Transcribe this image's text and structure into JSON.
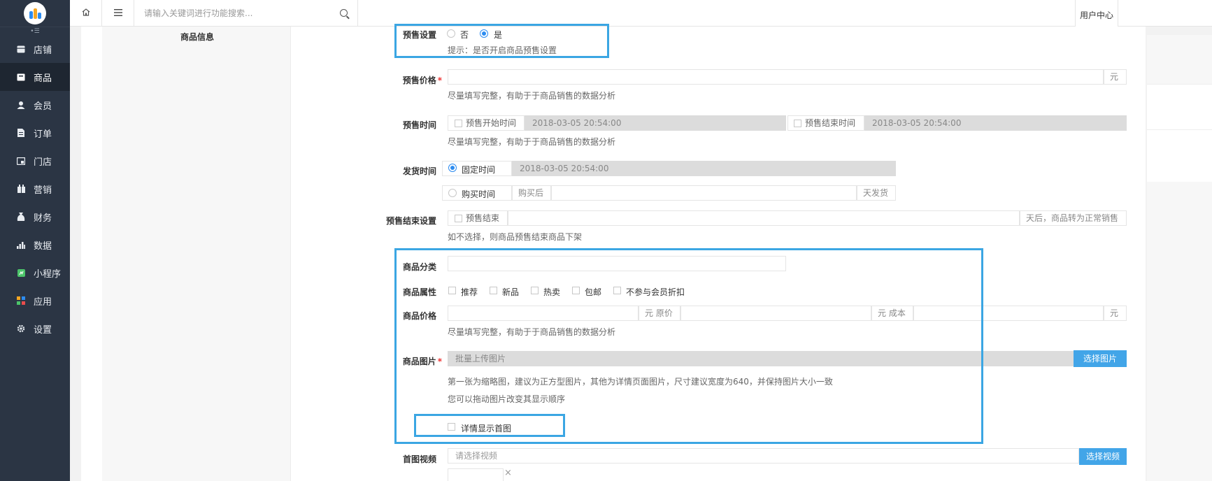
{
  "nav": {
    "items": [
      {
        "label": "店铺",
        "icon": "store-icon"
      },
      {
        "label": "商品",
        "icon": "goods-icon"
      },
      {
        "label": "会员",
        "icon": "member-icon"
      },
      {
        "label": "订单",
        "icon": "order-icon"
      },
      {
        "label": "门店",
        "icon": "shop-icon"
      },
      {
        "label": "营销",
        "icon": "marketing-icon"
      },
      {
        "label": "财务",
        "icon": "finance-icon"
      },
      {
        "label": "数据",
        "icon": "data-icon"
      },
      {
        "label": "小程序",
        "icon": "miniprogram-icon"
      },
      {
        "label": "应用",
        "icon": "apps-icon"
      },
      {
        "label": "设置",
        "icon": "gear-icon"
      }
    ],
    "collapse_glyph": "•☰"
  },
  "topbar": {
    "search_placeholder": "请输入关键词进行功能搜索...",
    "user_center": "用户中心"
  },
  "section": {
    "title": "商品信息"
  },
  "presale": {
    "label": "预售设置",
    "opt_no": "否",
    "opt_yes": "是",
    "hint": "提示：是否开启商品预售设置"
  },
  "presale_price": {
    "label": "预售价格",
    "unit": "元",
    "hint": "尽量填写完整，有助于于商品销售的数据分析"
  },
  "presale_time": {
    "label": "预售时间",
    "start_label": "预售开始时间",
    "start_value": "2018-03-05 20:54:00",
    "end_label": "预售结束时间",
    "end_value": "2018-03-05 20:54:00",
    "hint": "尽量填写完整，有助于于商品销售的数据分析"
  },
  "ship_time": {
    "label": "发货时间",
    "fixed_label": "固定时间",
    "fixed_value": "2018-03-05 20:54:00",
    "after_label": "购买时间",
    "after_prefix": "购买后",
    "after_suffix": "天发货"
  },
  "presale_end": {
    "label": "预售结束设置",
    "check_label": "预售结束",
    "suffix": "天后，商品转为正常销售",
    "hint": "如不选择，则商品预售结束商品下架"
  },
  "category": {
    "label": "商品分类"
  },
  "attrs": {
    "label": "商品属性",
    "options": [
      "推荐",
      "新品",
      "热卖",
      "包邮",
      "不参与会员折扣"
    ]
  },
  "price": {
    "label": "商品价格",
    "unit1": "元 原价",
    "unit2": "元 成本",
    "unit3": "元",
    "hint": "尽量填写完整，有助于于商品销售的数据分析"
  },
  "images": {
    "label": "商品图片",
    "placeholder": "批量上传图片",
    "button": "选择图片",
    "hint1": "第一张为缩略图，建议为正方型图片，其他为详情页面图片，尺寸建议宽度为640，并保持图片大小一致",
    "hint2": "您可以拖动图片改变其显示顺序",
    "detail_first": "详情显示首图"
  },
  "video": {
    "label": "首图视频",
    "placeholder": "请选择视频",
    "button": "选择视频",
    "remove_glyph": "×"
  },
  "colors": {
    "accent": "#42a5e8",
    "highlight": "#3ba6e3",
    "sidebar": "#2b3544"
  }
}
